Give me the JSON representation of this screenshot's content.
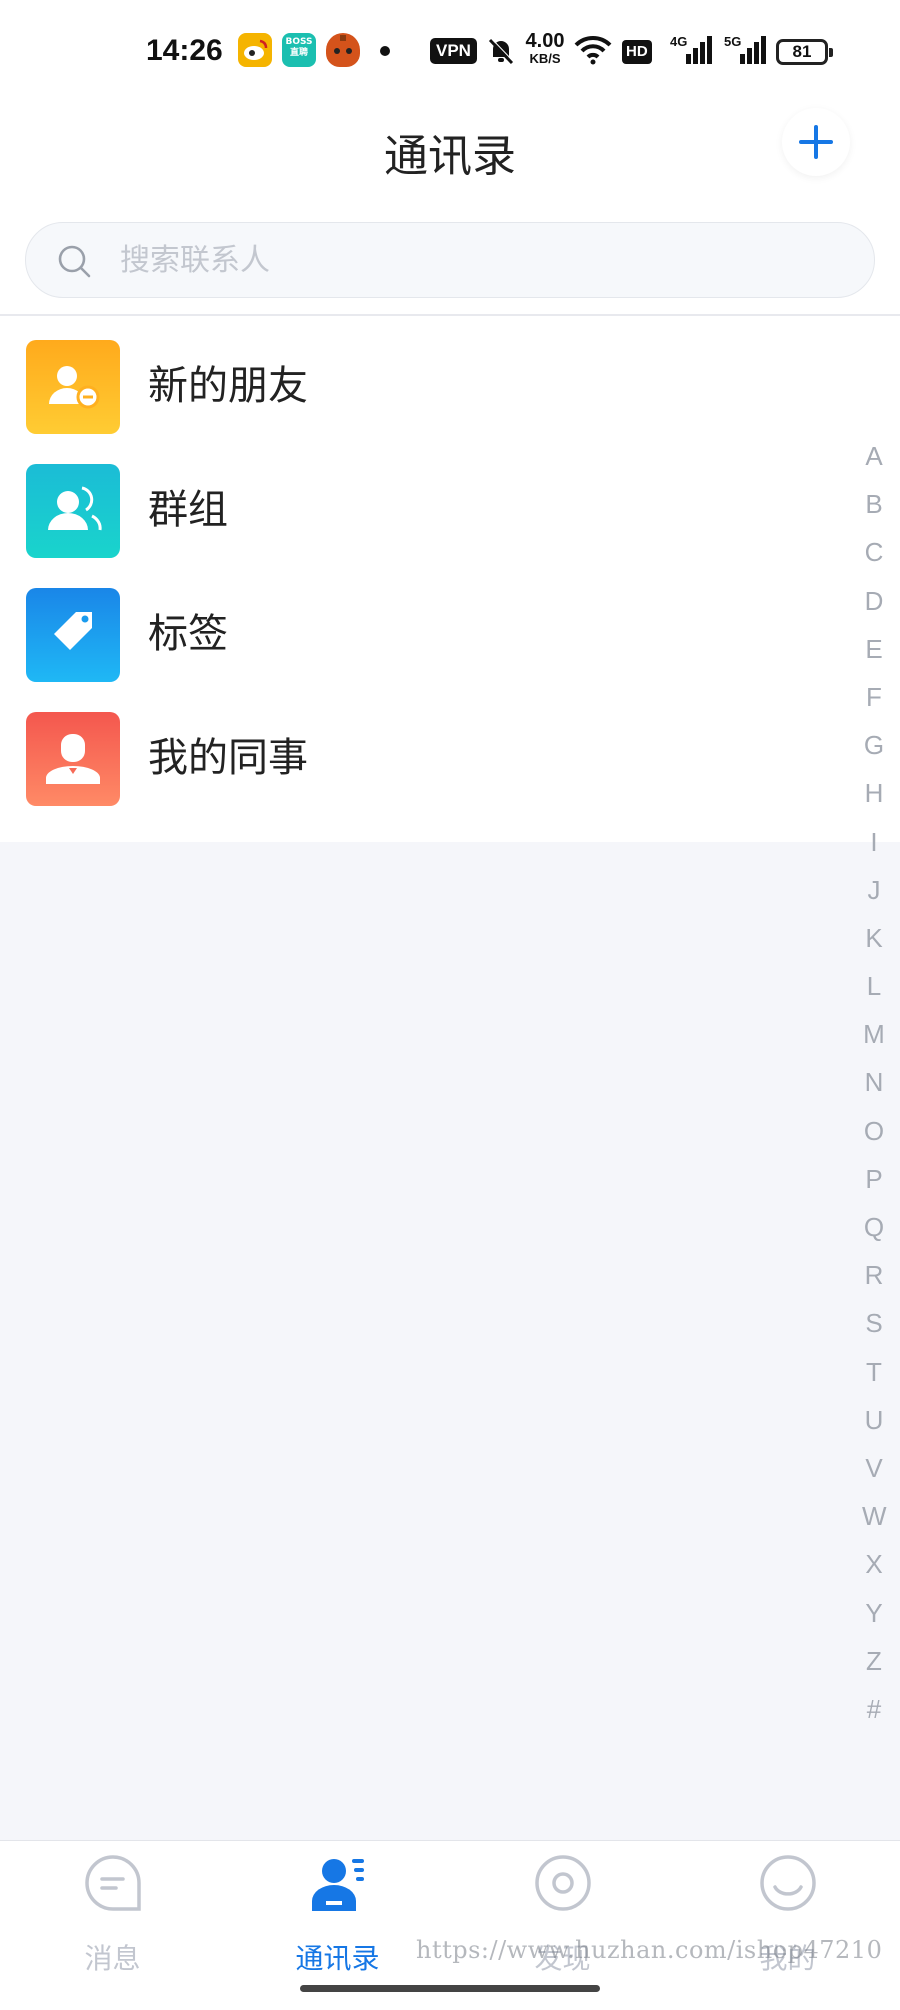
{
  "status_bar": {
    "time": "14:26",
    "boss_badge": "BOSS\n直聘",
    "vpn": "VPN",
    "net_speed_value": "4.00",
    "net_speed_unit": "KB/S",
    "hd": "HD",
    "signal_1": "4G",
    "signal_2": "5G",
    "battery": "81"
  },
  "header": {
    "title": "通讯录",
    "add_icon": "plus-icon",
    "accent_color": "#1677e5"
  },
  "search": {
    "placeholder": "搜索联系人",
    "icon": "search-icon"
  },
  "entries": [
    {
      "label": "新的朋友",
      "icon": "new-friend-icon",
      "color": "#ffb020"
    },
    {
      "label": "群组",
      "icon": "group-icon",
      "color": "#1bc4d2"
    },
    {
      "label": "标签",
      "icon": "tag-icon",
      "color": "#1a9bee"
    },
    {
      "label": "我的同事",
      "icon": "colleague-icon",
      "color": "#f66a57"
    }
  ],
  "alphabet_index": [
    "A",
    "B",
    "C",
    "D",
    "E",
    "F",
    "G",
    "H",
    "I",
    "J",
    "K",
    "L",
    "M",
    "N",
    "O",
    "P",
    "Q",
    "R",
    "S",
    "T",
    "U",
    "V",
    "W",
    "X",
    "Y",
    "Z",
    "#"
  ],
  "tabs": [
    {
      "label": "消息",
      "icon": "message-icon",
      "active": false
    },
    {
      "label": "通讯录",
      "icon": "contacts-icon",
      "active": true
    },
    {
      "label": "发现",
      "icon": "discover-icon",
      "active": false
    },
    {
      "label": "我的",
      "icon": "profile-icon",
      "active": false
    }
  ],
  "watermark": "https://www.huzhan.com/ishop47210"
}
